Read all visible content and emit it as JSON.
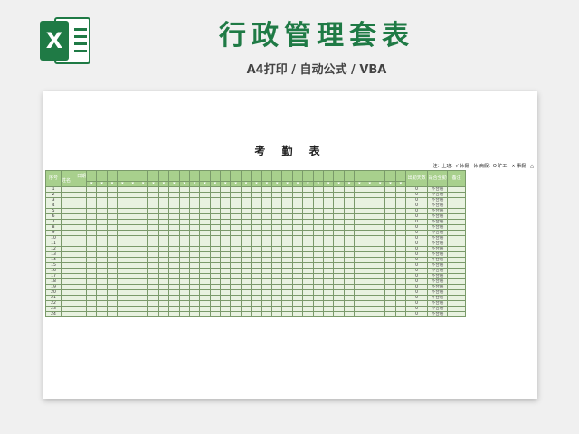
{
  "header": {
    "title": "行政管理套表",
    "subtitle": "A4打印 / 自动公式 / VBA",
    "logo_text": "X"
  },
  "sheet": {
    "title": "考 勤 表",
    "legend": "注：上班：√  休假：休  病假：O  旷工：×  事假：△",
    "headers": {
      "index": "序号",
      "date_label": "日期",
      "name_label": "姓名",
      "attendance_days": "出勤天数",
      "full_attendance": "是否全勤",
      "remark": "备注"
    },
    "rows": [
      {
        "no": "1",
        "days": "0",
        "status": "不合格"
      },
      {
        "no": "2",
        "days": "0",
        "status": "不合格"
      },
      {
        "no": "3",
        "days": "0",
        "status": "不合格"
      },
      {
        "no": "4",
        "days": "0",
        "status": "不合格"
      },
      {
        "no": "5",
        "days": "0",
        "status": "不合格"
      },
      {
        "no": "6",
        "days": "0",
        "status": "不合格"
      },
      {
        "no": "7",
        "days": "0",
        "status": "不合格"
      },
      {
        "no": "8",
        "days": "0",
        "status": "不合格"
      },
      {
        "no": "9",
        "days": "0",
        "status": "不合格"
      },
      {
        "no": "10",
        "days": "0",
        "status": "不合格"
      },
      {
        "no": "11",
        "days": "0",
        "status": "不合格"
      },
      {
        "no": "12",
        "days": "0",
        "status": "不合格"
      },
      {
        "no": "13",
        "days": "0",
        "status": "不合格"
      },
      {
        "no": "14",
        "days": "0",
        "status": "不合格"
      },
      {
        "no": "15",
        "days": "0",
        "status": "不合格"
      },
      {
        "no": "16",
        "days": "0",
        "status": "不合格"
      },
      {
        "no": "17",
        "days": "0",
        "status": "不合格"
      },
      {
        "no": "18",
        "days": "0",
        "status": "不合格"
      },
      {
        "no": "19",
        "days": "0",
        "status": "不合格"
      },
      {
        "no": "20",
        "days": "0",
        "status": "不合格"
      },
      {
        "no": "21",
        "days": "0",
        "status": "不合格"
      },
      {
        "no": "22",
        "days": "0",
        "status": "不合格"
      },
      {
        "no": "23",
        "days": "0",
        "status": "不合格"
      },
      {
        "no": "24",
        "days": "0",
        "status": "不合格"
      }
    ]
  },
  "colors": {
    "brand": "#1f7a45",
    "header_fill": "#a8d08d",
    "row_fill": "#e8f2e0"
  }
}
